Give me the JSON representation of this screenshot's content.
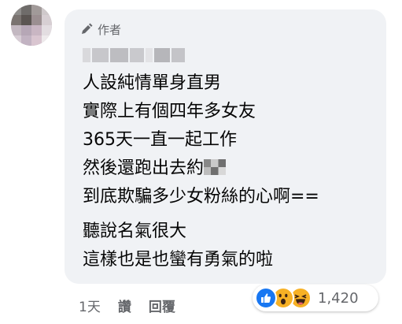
{
  "comment": {
    "author_badge": "作者",
    "lines_group1": [
      "人設純情單身直男",
      "實際上有個四年多女友",
      "365天一直一起工作",
      "然後還跑出去約",
      "到底欺騙多少女粉絲的心啊=="
    ],
    "lines_group2": [
      "聽說名氣很大",
      "這樣也是也蠻有勇氣的啦"
    ]
  },
  "actions": {
    "time": "1天",
    "like": "讚",
    "reply": "回覆"
  },
  "reactions": {
    "icons": [
      "like-icon",
      "wow-icon",
      "haha-icon"
    ],
    "count": "1,420"
  },
  "colors": {
    "bubble": "#f0f2f5",
    "meta_text": "#65676b",
    "like_blue": "#1877f2",
    "emoji_yellow": "#f7b125"
  }
}
